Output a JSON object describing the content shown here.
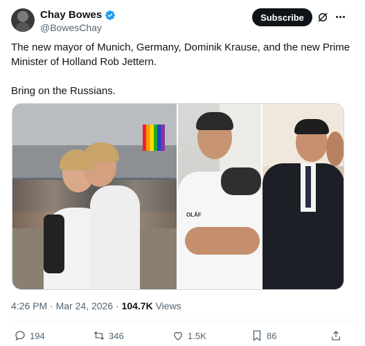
{
  "author": {
    "display_name": "Chay Bowes",
    "handle": "@BowesChay",
    "verified": true,
    "subscribe_label": "Subscribe"
  },
  "post": {
    "text": "The new mayor of Munich, Germany, Dominik Krause, and the new Prime Minister of Holland Rob Jettern.\n\nBring on the Russians.",
    "images": [
      {
        "icon": "photo-two-men-kissing-street",
        "overlay_text": ""
      },
      {
        "icon": "photo-smiling-man-selfie",
        "overlay_text": "OLÁF"
      },
      {
        "icon": "photo-men-in-suits-kissing",
        "overlay_text": ""
      }
    ]
  },
  "meta": {
    "time": "4:26 PM",
    "separator": "·",
    "date": "Mar 24, 2026",
    "views_count": "104.7K",
    "views_label": "Views"
  },
  "actions": {
    "replies": "194",
    "reposts": "346",
    "likes": "1.5K",
    "bookmarks": "86"
  },
  "colors": {
    "text": "#0f1419",
    "secondary": "#536471",
    "verified": "#1d9bf0",
    "border": "#cfd9de"
  }
}
